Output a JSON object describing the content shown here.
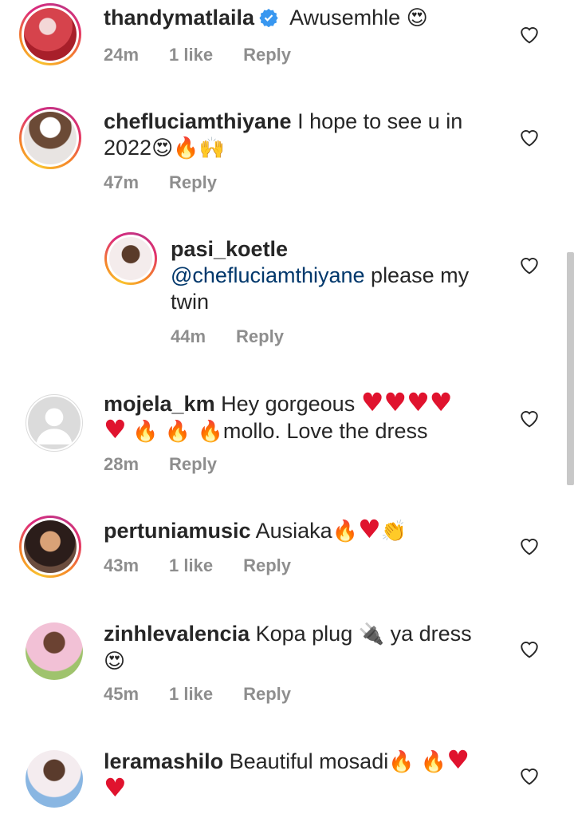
{
  "comments": [
    {
      "username": "thandymatlaila",
      "text": "Awusemhle",
      "emoji": "😍",
      "time": "24m",
      "likes": "1 like",
      "reply": "Reply"
    },
    {
      "username": "chefluciamthiyane",
      "text": "I hope to see u in 2022",
      "emoji": "😍🔥🙌",
      "time": "47m",
      "reply": "Reply"
    },
    {
      "username": "pasi_koetle",
      "mention": "@chefluciamthiyane",
      "text": "please my twin",
      "time": "44m",
      "reply": "Reply"
    },
    {
      "username": "mojela_km",
      "text": "Hey gorgeous",
      "text2": "mollo. Love the dress",
      "time": "28m",
      "reply": "Reply"
    },
    {
      "username": "pertuniamusic",
      "text": "Ausiaka",
      "time": "43m",
      "likes": "1 like",
      "reply": "Reply"
    },
    {
      "username": "zinhlevalencia",
      "text": "Kopa plug",
      "text2": "ya dress",
      "emoji": "😍",
      "time": "45m",
      "likes": "1 like",
      "reply": "Reply"
    },
    {
      "username": "leramashilo",
      "text": "Beautiful mosadi",
      "time": "",
      "reply": ""
    }
  ],
  "colors": {
    "like_heart": "#262626",
    "mention": "#00376b",
    "meta": "#8e8e8e",
    "red_heart": "#e0132e"
  },
  "icons": {
    "like": "heart-outline-icon",
    "verified": "verified-badge-icon"
  }
}
